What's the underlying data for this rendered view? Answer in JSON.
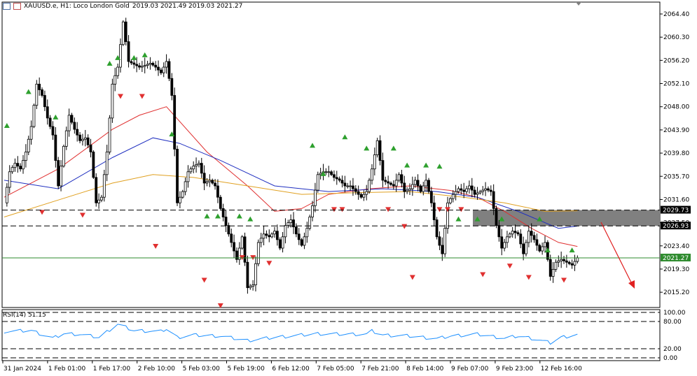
{
  "header": {
    "symbol": "XAUUSD.e, H1:  Loco London Gold",
    "ohlc": "2019.03 2021.49 2019.03 2021.27"
  },
  "rsi": {
    "label": "RSI(14) 51.15",
    "levels": [
      80,
      20
    ],
    "value": 51.15
  },
  "price_axis": {
    "ticks": [
      "2064.40",
      "2060.30",
      "2056.20",
      "2052.10",
      "2048.00",
      "2043.90",
      "2039.80",
      "2035.70",
      "2031.60",
      "2027.50",
      "2023.40",
      "2019.30",
      "2015.20"
    ],
    "current_price": "2021.27",
    "level_upper": "2029.73",
    "level_lower": "2026.93"
  },
  "rsi_axis": {
    "ticks": [
      "100.00",
      "80.00",
      "20.00",
      "0.00"
    ]
  },
  "time_axis": {
    "ticks": [
      "31 Jan 2024",
      "1 Feb 01:00",
      "1 Feb 17:00",
      "2 Feb 10:00",
      "5 Feb 03:00",
      "5 Feb 19:00",
      "6 Feb 12:00",
      "7 Feb 05:00",
      "7 Feb 21:00",
      "8 Feb 14:00",
      "9 Feb 07:00",
      "9 Feb 23:00",
      "12 Feb 16:00"
    ]
  },
  "colors": {
    "bull_candle": "#ffffff",
    "bear_candle": "#000000",
    "ma_fast": "#e03030",
    "ma_mid": "#2030c0",
    "ma_slow": "#e0a020",
    "rsi_line": "#1e90ff",
    "current_price_line": "#2e8b2e",
    "resistance_zone": "#808080",
    "arrow": "#e02020",
    "fractal_up": "#2ea02e",
    "fractal_down": "#e03030"
  },
  "chart_data": {
    "type": "candlestick",
    "title": "XAUUSD.e, H1:  Loco London Gold",
    "ylim": [
      2012.5,
      2066.5
    ],
    "resistance_zone": [
      2026.93,
      2029.73
    ],
    "forecast": "down",
    "close_path": [
      [
        0,
        2031.0
      ],
      [
        4,
        2036.5
      ],
      [
        8,
        2038.0
      ],
      [
        12,
        2037.0
      ],
      [
        16,
        2040.0
      ],
      [
        20,
        2044.5
      ],
      [
        24,
        2052.0
      ],
      [
        28,
        2050.0
      ],
      [
        32,
        2046.0
      ],
      [
        36,
        2043.0
      ],
      [
        40,
        2034.0
      ],
      [
        44,
        2041.0
      ],
      [
        48,
        2046.5
      ],
      [
        52,
        2044.0
      ],
      [
        56,
        2042.0
      ],
      [
        60,
        2042.5
      ],
      [
        64,
        2040.0
      ],
      [
        68,
        2031.0
      ],
      [
        72,
        2032.0
      ],
      [
        76,
        2040.0
      ],
      [
        80,
        2052.0
      ],
      [
        84,
        2055.0
      ],
      [
        88,
        2063.0
      ],
      [
        92,
        2056.0
      ],
      [
        96,
        2055.5
      ],
      [
        100,
        2055.0
      ],
      [
        104,
        2055.3
      ],
      [
        108,
        2055.7
      ],
      [
        112,
        2055.0
      ],
      [
        116,
        2054.0
      ],
      [
        120,
        2056.0
      ],
      [
        124,
        2050.0
      ],
      [
        128,
        2031.0
      ],
      [
        132,
        2033.0
      ],
      [
        136,
        2036.5
      ],
      [
        140,
        2037.5
      ],
      [
        144,
        2038.0
      ],
      [
        148,
        2034.5
      ],
      [
        152,
        2035.0
      ],
      [
        156,
        2034.0
      ],
      [
        160,
        2030.0
      ],
      [
        164,
        2027.0
      ],
      [
        168,
        2024.0
      ],
      [
        172,
        2021.0
      ],
      [
        176,
        2025.0
      ],
      [
        180,
        2016.0
      ],
      [
        184,
        2016.5
      ],
      [
        188,
        2024.0
      ],
      [
        192,
        2025.5
      ],
      [
        196,
        2025.0
      ],
      [
        200,
        2026.0
      ],
      [
        204,
        2023.0
      ],
      [
        208,
        2027.0
      ],
      [
        212,
        2028.0
      ],
      [
        216,
        2025.5
      ],
      [
        220,
        2023.5
      ],
      [
        224,
        2026.5
      ],
      [
        228,
        2030.5
      ],
      [
        232,
        2036.0
      ],
      [
        236,
        2036.5
      ],
      [
        240,
        2036.5
      ],
      [
        244,
        2035.5
      ],
      [
        248,
        2035.0
      ],
      [
        252,
        2034.0
      ],
      [
        256,
        2034.0
      ],
      [
        260,
        2033.0
      ],
      [
        264,
        2032.0
      ],
      [
        268,
        2033.0
      ],
      [
        272,
        2037.0
      ],
      [
        276,
        2042.0
      ],
      [
        280,
        2035.0
      ],
      [
        284,
        2034.5
      ],
      [
        288,
        2034.0
      ],
      [
        292,
        2036.0
      ],
      [
        296,
        2033.0
      ],
      [
        300,
        2033.5
      ],
      [
        304,
        2035.0
      ],
      [
        308,
        2033.0
      ],
      [
        312,
        2035.0
      ],
      [
        316,
        2031.0
      ],
      [
        320,
        2025.0
      ],
      [
        324,
        2022.0
      ],
      [
        328,
        2031.0
      ],
      [
        332,
        2032.5
      ],
      [
        336,
        2033.5
      ],
      [
        340,
        2033.0
      ],
      [
        344,
        2034.0
      ],
      [
        348,
        2032.5
      ],
      [
        352,
        2033.0
      ],
      [
        356,
        2033.5
      ],
      [
        360,
        2033.0
      ],
      [
        364,
        2027.0
      ],
      [
        368,
        2023.0
      ],
      [
        372,
        2025.0
      ],
      [
        376,
        2026.0
      ],
      [
        380,
        2025.5
      ],
      [
        384,
        2022.0
      ],
      [
        388,
        2026.0
      ],
      [
        392,
        2024.5
      ],
      [
        396,
        2022.5
      ],
      [
        400,
        2024.0
      ],
      [
        404,
        2018.0
      ],
      [
        408,
        2020.5
      ],
      [
        412,
        2021.0
      ],
      [
        416,
        2020.5
      ],
      [
        420,
        2020.0
      ],
      [
        424,
        2021.3
      ]
    ],
    "moving_averages": [
      {
        "color": "#e03030",
        "points": [
          [
            0,
            2032.0
          ],
          [
            40,
            2037.0
          ],
          [
            80,
            2044.0
          ],
          [
            100,
            2046.5
          ],
          [
            120,
            2048.0
          ],
          [
            150,
            2040.0
          ],
          [
            180,
            2034.0
          ],
          [
            200,
            2029.5
          ],
          [
            220,
            2030.0
          ],
          [
            240,
            2032.5
          ],
          [
            270,
            2033.5
          ],
          [
            300,
            2034.0
          ],
          [
            330,
            2033.2
          ],
          [
            350,
            2032.0
          ],
          [
            370,
            2029.5
          ],
          [
            390,
            2026.5
          ],
          [
            410,
            2024.0
          ],
          [
            424,
            2023.3
          ]
        ]
      },
      {
        "color": "#2030c0",
        "points": [
          [
            0,
            2035.0
          ],
          [
            40,
            2033.5
          ],
          [
            80,
            2039.0
          ],
          [
            110,
            2042.5
          ],
          [
            130,
            2041.5
          ],
          [
            160,
            2038.5
          ],
          [
            200,
            2034.0
          ],
          [
            240,
            2033.0
          ],
          [
            280,
            2033.5
          ],
          [
            320,
            2033.0
          ],
          [
            350,
            2032.0
          ],
          [
            380,
            2029.5
          ],
          [
            410,
            2026.5
          ],
          [
            424,
            2026.9
          ]
        ]
      },
      {
        "color": "#e0a020",
        "points": [
          [
            0,
            2028.5
          ],
          [
            40,
            2031.5
          ],
          [
            80,
            2034.5
          ],
          [
            110,
            2036.0
          ],
          [
            140,
            2035.5
          ],
          [
            180,
            2034.0
          ],
          [
            220,
            2032.5
          ],
          [
            260,
            2032.8
          ],
          [
            300,
            2033.0
          ],
          [
            340,
            2032.0
          ],
          [
            370,
            2031.0
          ],
          [
            400,
            2029.5
          ],
          [
            424,
            2029.6
          ]
        ]
      }
    ],
    "rsi_path": [
      [
        0,
        58
      ],
      [
        20,
        60
      ],
      [
        36,
        43
      ],
      [
        44,
        53
      ],
      [
        56,
        52
      ],
      [
        70,
        45
      ],
      [
        84,
        74
      ],
      [
        96,
        60
      ],
      [
        108,
        59
      ],
      [
        116,
        58
      ],
      [
        120,
        64
      ],
      [
        128,
        45
      ],
      [
        140,
        50
      ],
      [
        160,
        48
      ],
      [
        180,
        38
      ],
      [
        200,
        45
      ],
      [
        220,
        50
      ],
      [
        232,
        53
      ],
      [
        248,
        52
      ],
      [
        268,
        52
      ],
      [
        272,
        59
      ],
      [
        280,
        50
      ],
      [
        300,
        48
      ],
      [
        320,
        42
      ],
      [
        330,
        48
      ],
      [
        350,
        52
      ],
      [
        370,
        43
      ],
      [
        380,
        48
      ],
      [
        390,
        43
      ],
      [
        404,
        33
      ],
      [
        412,
        45
      ],
      [
        424,
        51
      ]
    ]
  }
}
